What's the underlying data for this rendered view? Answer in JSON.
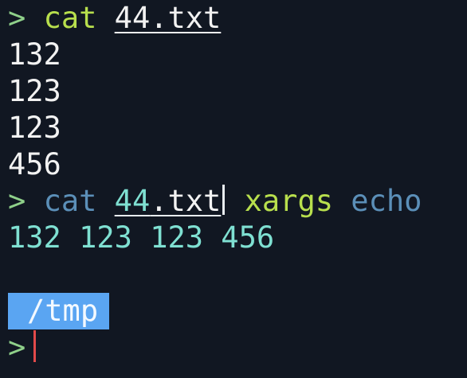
{
  "terminal": {
    "prompt_symbol": ">",
    "command1": {
      "cmd": "cat",
      "file": "44.txt"
    },
    "output1": [
      "132",
      "123",
      "123",
      "456"
    ],
    "command2": {
      "cmd": "cat",
      "file_part1": "44",
      "file_part2": ".txt",
      "pipe_cmd": "xargs",
      "pipe_arg": "echo"
    },
    "output2": "132 123 123 456",
    "cwd": "/tmp"
  },
  "colors": {
    "background": "#111722",
    "prompt": "#8fd08a",
    "command_green": "#b8df4d",
    "command_blue": "#5b8fb8",
    "output_teal": "#7fe0d2",
    "dir_badge": "#5aa5f2",
    "cursor": "#e24a4a"
  }
}
